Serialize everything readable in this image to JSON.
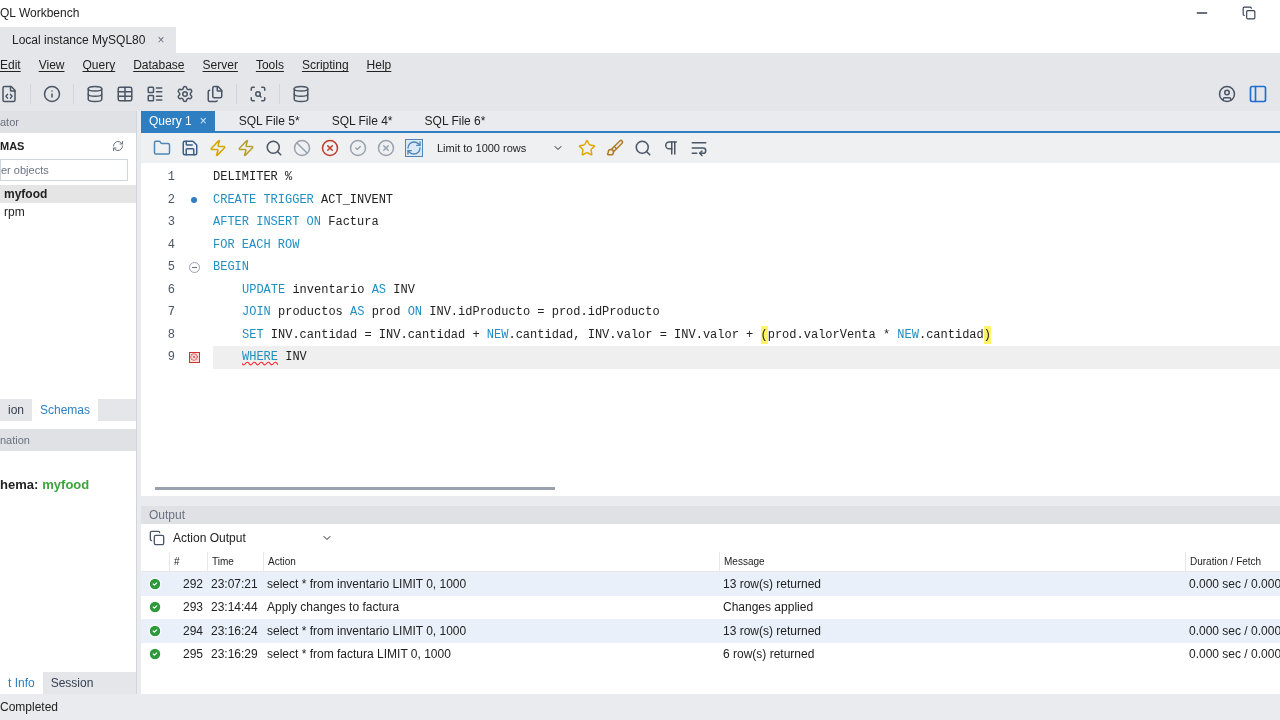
{
  "window": {
    "title": "QL Workbench"
  },
  "connection_tabs": [
    {
      "label": "Local instance MySQL80",
      "close": "×",
      "selected": true
    }
  ],
  "menu": [
    "Edit",
    "View",
    "Query",
    "Database",
    "Server",
    "Tools",
    "Scripting",
    "Help"
  ],
  "sidebar": {
    "navigator_header": "ator",
    "schemas_title": "MAS",
    "filter": {
      "placeholder": "er objects"
    },
    "schemas": [
      {
        "name": "myfood",
        "selected": true
      },
      {
        "name": "rpm",
        "selected": false
      }
    ],
    "tabs": [
      {
        "label": "ion",
        "selected": false
      },
      {
        "label": "Schemas",
        "selected": true
      }
    ],
    "info_header": "nation",
    "info_label": "hema:",
    "info_value": "myfood",
    "bottom_tabs": [
      {
        "label": "t Info",
        "selected": true
      },
      {
        "label": "Session",
        "selected": false
      }
    ]
  },
  "editor_tabs": [
    {
      "label": "Query 1",
      "selected": true,
      "close": "×"
    },
    {
      "label": "SQL File 5*",
      "selected": false
    },
    {
      "label": "SQL File 4*",
      "selected": false
    },
    {
      "label": "SQL File 6*",
      "selected": false
    }
  ],
  "limit_select": {
    "value": "Limit to 1000 rows"
  },
  "code": [
    {
      "number": "1",
      "dot": false,
      "fold": false,
      "error": false,
      "indented": false,
      "current": false,
      "tokens": [
        {
          "text": "DELIMITER %",
          "kind": "plain"
        }
      ]
    },
    {
      "number": "2",
      "dot": true,
      "fold": false,
      "error": false,
      "indented": false,
      "current": false,
      "tokens": [
        {
          "text": "CREATE TRIGGER",
          "kind": "keyword"
        },
        {
          "text": " ACT_INVENT",
          "kind": "plain"
        }
      ]
    },
    {
      "number": "3",
      "dot": false,
      "fold": false,
      "error": false,
      "indented": false,
      "current": false,
      "tokens": [
        {
          "text": "AFTER INSERT ON",
          "kind": "keyword"
        },
        {
          "text": " Factura",
          "kind": "plain"
        }
      ]
    },
    {
      "number": "4",
      "dot": false,
      "fold": false,
      "error": false,
      "indented": false,
      "current": false,
      "tokens": [
        {
          "text": "FOR EACH ROW",
          "kind": "keyword"
        }
      ]
    },
    {
      "number": "5",
      "dot": false,
      "fold": true,
      "error": false,
      "indented": false,
      "current": false,
      "tokens": [
        {
          "text": "BEGIN",
          "kind": "keyword"
        }
      ]
    },
    {
      "number": "6",
      "dot": false,
      "fold": false,
      "error": false,
      "indented": true,
      "current": false,
      "tokens": [
        {
          "text": "UPDATE",
          "kind": "keyword"
        },
        {
          "text": " inventario ",
          "kind": "plain"
        },
        {
          "text": "AS",
          "kind": "keyword"
        },
        {
          "text": " INV",
          "kind": "plain"
        }
      ]
    },
    {
      "number": "7",
      "dot": false,
      "fold": false,
      "error": false,
      "indented": true,
      "current": false,
      "tokens": [
        {
          "text": "JOIN",
          "kind": "keyword"
        },
        {
          "text": " productos ",
          "kind": "plain"
        },
        {
          "text": "AS",
          "kind": "keyword"
        },
        {
          "text": " prod ",
          "kind": "plain"
        },
        {
          "text": "ON",
          "kind": "keyword"
        },
        {
          "text": " INV.idProducto = prod.idProducto",
          "kind": "plain"
        }
      ]
    },
    {
      "number": "8",
      "dot": false,
      "fold": false,
      "error": false,
      "indented": true,
      "current": false,
      "tokens": [
        {
          "text": "SET",
          "kind": "keyword"
        },
        {
          "text": " INV.cantidad = INV.cantidad + ",
          "kind": "plain"
        },
        {
          "text": "NEW",
          "kind": "keyword"
        },
        {
          "text": ".cantidad, INV.valor = INV.valor + ",
          "kind": "plain"
        },
        {
          "text": "(",
          "kind": "match"
        },
        {
          "text": "prod.valorVenta * ",
          "kind": "plain"
        },
        {
          "text": "NEW",
          "kind": "keyword"
        },
        {
          "text": ".cantidad",
          "kind": "plain"
        },
        {
          "text": ")",
          "kind": "match"
        }
      ]
    },
    {
      "number": "9",
      "dot": false,
      "fold": false,
      "error": true,
      "indented": true,
      "current": true,
      "tokens": [
        {
          "text": "WHERE",
          "kind": "error"
        },
        {
          "text": " INV",
          "kind": "plain"
        }
      ]
    }
  ],
  "output": {
    "title": "Output",
    "view": "Action Output",
    "columns": [
      "#",
      "Time",
      "Action",
      "Message",
      "Duration / Fetch"
    ],
    "rows": [
      {
        "success": true,
        "cells": [
          "292",
          "23:07:21",
          "select * from inventario LIMIT 0, 1000",
          "13 row(s) returned",
          "0.000 sec / 0.000"
        ]
      },
      {
        "success": true,
        "cells": [
          "293",
          "23:14:44",
          "Apply changes to factura",
          "Changes applied"
        ]
      },
      {
        "success": true,
        "cells": [
          "294",
          "23:16:24",
          "select * from inventario LIMIT 0, 1000",
          "13 row(s) returned",
          "0.000 sec / 0.000"
        ]
      },
      {
        "success": true,
        "cells": [
          "295",
          "23:16:29",
          "select * from factura LIMIT 0, 1000",
          "6 row(s) returned",
          "0.000 sec / 0.000"
        ]
      }
    ]
  },
  "status_bar": "Completed"
}
